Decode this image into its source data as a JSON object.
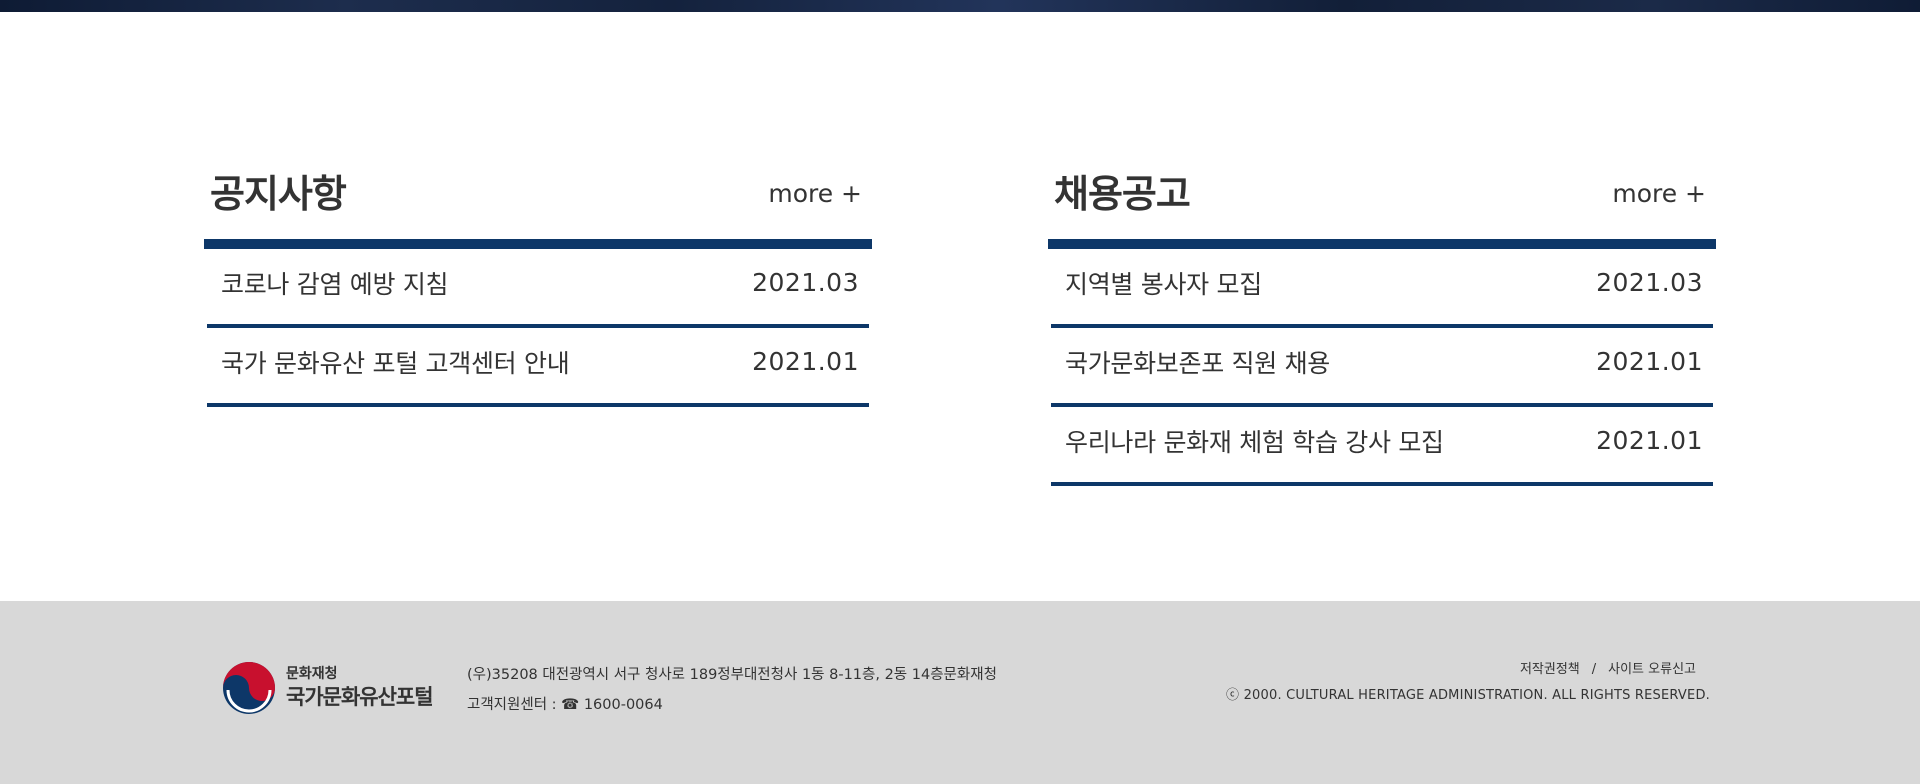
{
  "notice_board": {
    "title": "공지사항",
    "more_label": "more +",
    "items": [
      {
        "title": "코로나 감염 예방 지침",
        "date": "2021.03"
      },
      {
        "title": "국가 문화유산 포털 고객센터 안내",
        "date": "2021.01"
      }
    ]
  },
  "recruit_board": {
    "title": "채용공고",
    "more_label": "more +",
    "items": [
      {
        "title": "지역별 봉사자 모집",
        "date": "2021.03"
      },
      {
        "title": "국가문화보존포 직원 채용",
        "date": "2021.01"
      },
      {
        "title": "우리나라 문화재 체험 학습 강사 모집",
        "date": "2021.01"
      }
    ]
  },
  "footer": {
    "logo": {
      "small_text": "문화재청",
      "main_text": "국가문화유산포털"
    },
    "address_line": "(우)35208 대전광역시 서구 청사로 189정부대전청사 1동 8-11층, 2동 14층문화재청",
    "support_line": "고객지원센터 : ☎ 1600-0064",
    "links": [
      "저작권정책",
      "사이트 오류신고"
    ],
    "link_separator": "/",
    "copyright": "ⓒ 2000. CULTURAL HERITAGE ADMINISTRATION. ALL RIGHTS RESERVED."
  },
  "colors": {
    "accent_navy": "#0d3768",
    "footer_bg": "#d8d8d8",
    "emblem_red": "#c8102e",
    "emblem_blue": "#0d3768",
    "text": "#333333"
  }
}
